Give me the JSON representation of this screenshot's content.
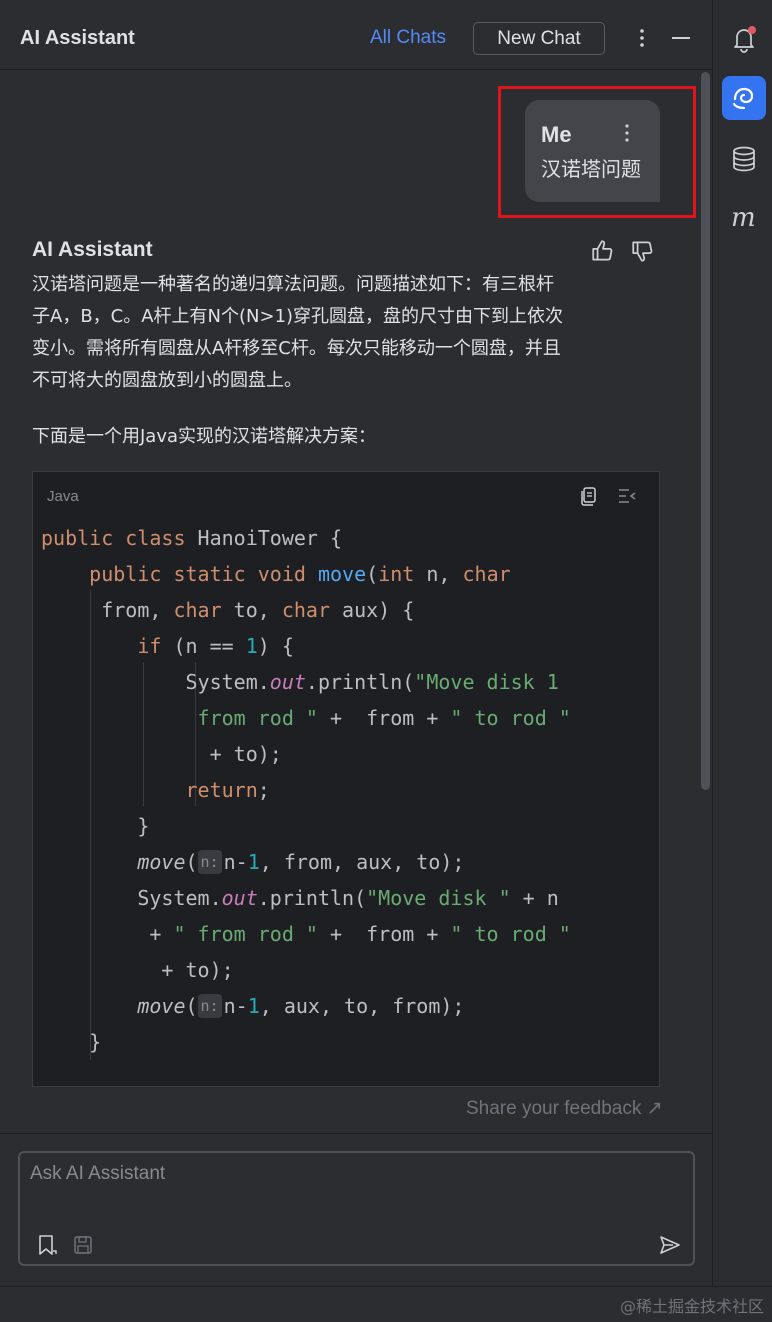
{
  "header": {
    "title": "AI Assistant",
    "all_chats": "All Chats",
    "new_chat": "New Chat"
  },
  "user_message": {
    "sender": "Me",
    "text": "汉诺塔问题"
  },
  "assistant_message": {
    "sender": "AI Assistant",
    "paragraph_lines": [
      "汉诺塔问题是一种著名的递归算法问题。问题描述如下：有三根杆",
      "子A，B，C。A杆上有N个(N>1)穿孔圆盘，盘的尺寸由下到上依次",
      "变小。需将所有圆盘从A杆移至C杆。每次只能移动一个圆盘，并且",
      "不可将大的圆盘放到小的圆盘上。"
    ],
    "intro": "下面是一个用Java实现的汉诺塔解决方案：",
    "code_language": "Java",
    "parameter_hint": "n:"
  },
  "feedback": {
    "label": "Share your feedback ↗"
  },
  "input": {
    "placeholder": "Ask AI Assistant"
  },
  "watermark": "@稀土掘金技术社区",
  "colors": {
    "accent": "#3574f0",
    "link": "#548af7",
    "highlight_box": "#e0141c",
    "keyword": "#cf8e6d",
    "function": "#56a8f5",
    "string": "#6aab73",
    "number": "#2aacb8"
  },
  "icons": {
    "header": [
      "more-vertical-icon",
      "minimize-icon"
    ],
    "right_strip": [
      "notifications-icon",
      "ai-assistant-icon",
      "database-icon",
      "maven-icon"
    ],
    "code": [
      "copy-icon",
      "insert-icon"
    ],
    "input": [
      "bookmark-icon",
      "save-icon",
      "send-icon"
    ]
  }
}
